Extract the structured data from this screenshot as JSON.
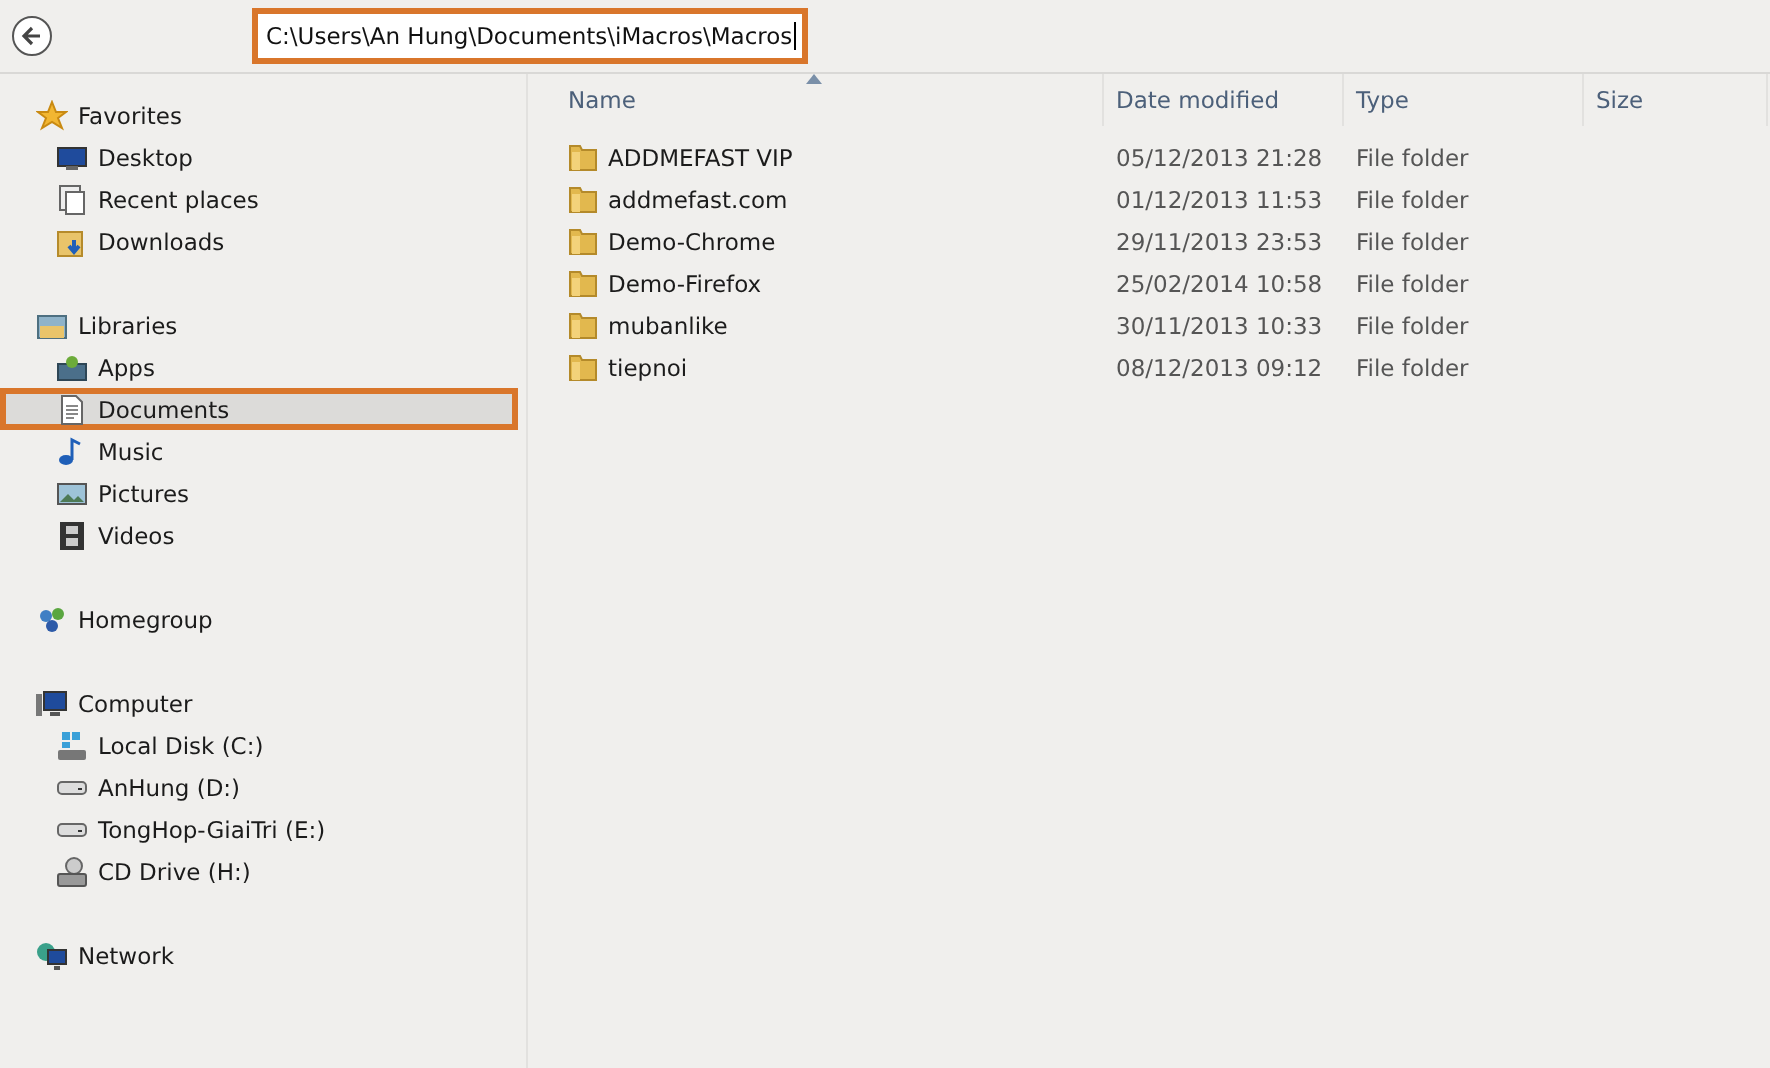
{
  "address_bar": {
    "path": "C:\\Users\\An Hung\\Documents\\iMacros\\Macros",
    "highlighted": true
  },
  "navigation": [
    {
      "label": "Favorites",
      "children": [
        {
          "label": "Desktop",
          "selected": false,
          "highlighted": false
        },
        {
          "label": "Recent places",
          "selected": false,
          "highlighted": false
        },
        {
          "label": "Downloads",
          "selected": false,
          "highlighted": false
        }
      ]
    },
    {
      "label": "Libraries",
      "children": [
        {
          "label": "Apps",
          "selected": false,
          "highlighted": false
        },
        {
          "label": "Documents",
          "selected": true,
          "highlighted": true
        },
        {
          "label": "Music",
          "selected": false,
          "highlighted": false
        },
        {
          "label": "Pictures",
          "selected": false,
          "highlighted": false
        },
        {
          "label": "Videos",
          "selected": false,
          "highlighted": false
        }
      ]
    },
    {
      "label": "Homegroup"
    },
    {
      "label": "Computer",
      "children": [
        {
          "label": "Local Disk (C:)",
          "selected": false,
          "highlighted": false
        },
        {
          "label": "AnHung (D:)",
          "selected": false,
          "highlighted": false
        },
        {
          "label": "TongHop-GiaiTri (E:)",
          "selected": false,
          "highlighted": false
        },
        {
          "label": "CD Drive (H:)",
          "selected": false,
          "highlighted": false
        }
      ]
    },
    {
      "label": "Network"
    }
  ],
  "file_list": {
    "columns": [
      "Name",
      "Date modified",
      "Type",
      "Size"
    ],
    "rows": [
      {
        "name": "ADDMEFAST VIP",
        "date_modified": "05/12/2013 21:28",
        "type": "File folder"
      },
      {
        "name": "addmefast.com",
        "date_modified": "01/12/2013 11:53",
        "type": "File folder"
      },
      {
        "name": "Demo-Chrome",
        "date_modified": "29/11/2013 23:53",
        "type": "File folder"
      },
      {
        "name": "Demo-Firefox",
        "date_modified": "25/02/2014 10:58",
        "type": "File folder"
      },
      {
        "name": "mubanlike",
        "date_modified": "30/11/2013 10:33",
        "type": "File folder"
      },
      {
        "name": "tiepnoi",
        "date_modified": "08/12/2013 09:12",
        "type": "File folder"
      }
    ]
  }
}
